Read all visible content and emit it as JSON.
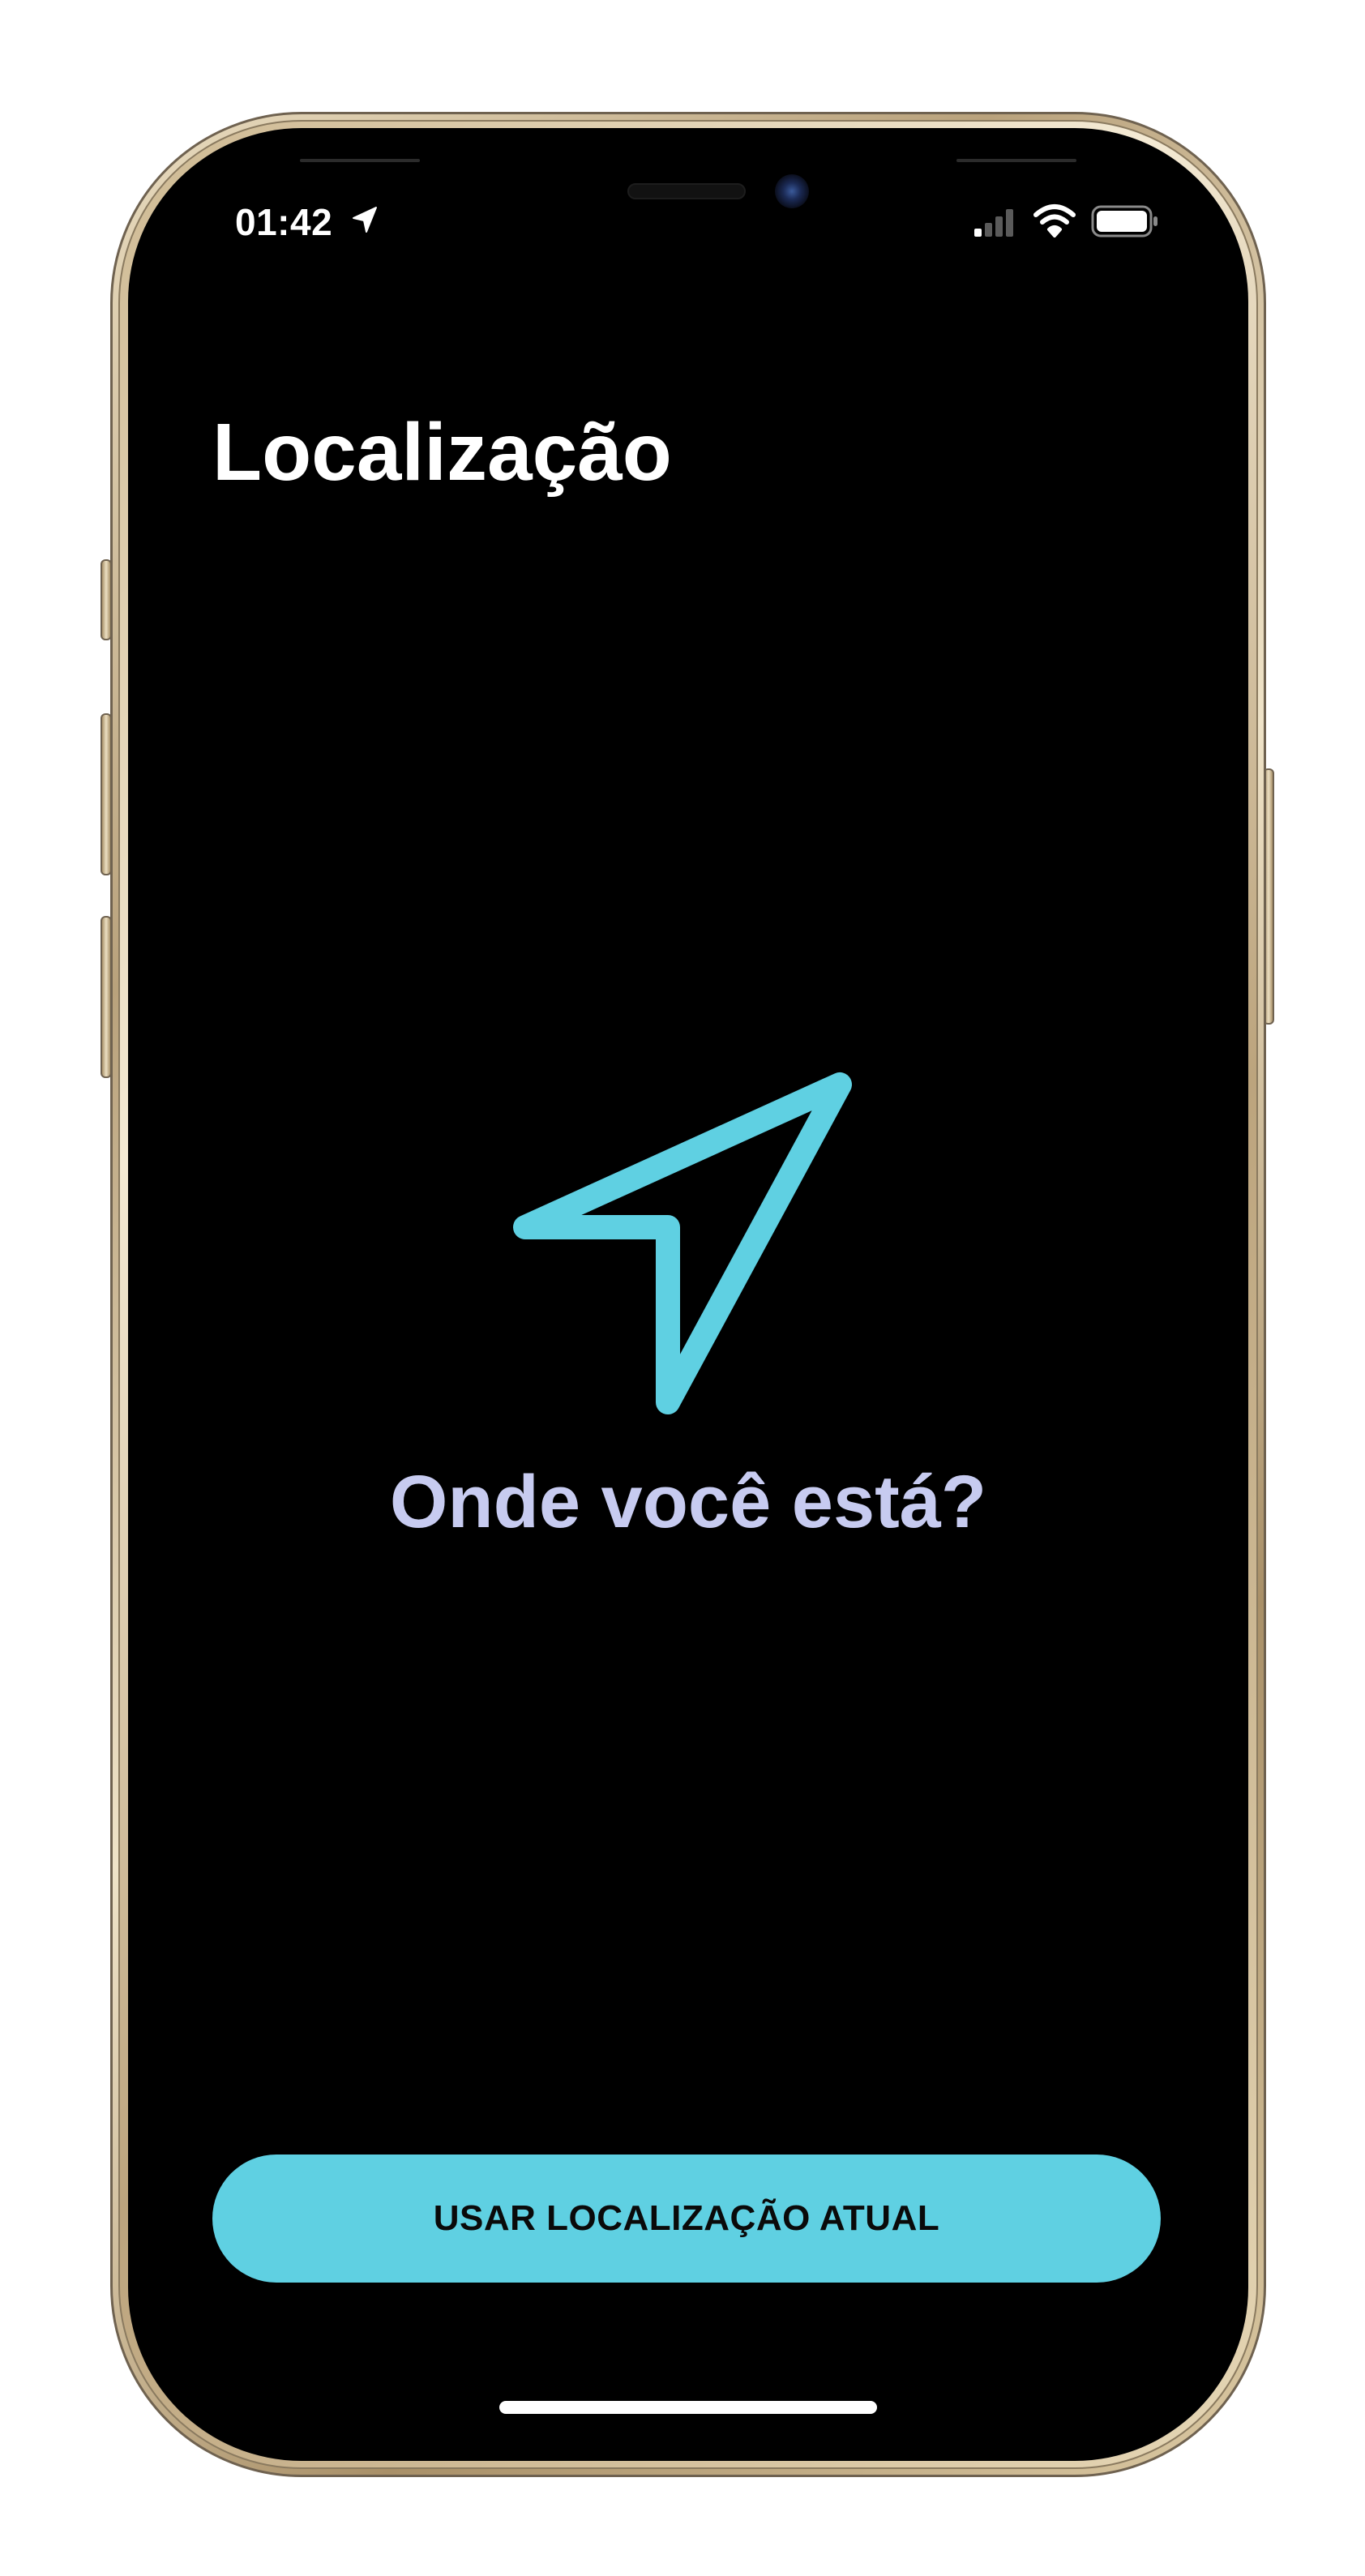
{
  "status_bar": {
    "time": "01:42",
    "location_icon": "location-arrow-icon",
    "signal_icon": "cellular-signal-icon",
    "wifi_icon": "wifi-icon",
    "battery_icon": "battery-full-icon"
  },
  "header": {
    "title": "Localização"
  },
  "main": {
    "icon": "navigation-arrow-icon",
    "prompt": "Onde você está?"
  },
  "actions": {
    "use_current_location_label": "USAR LOCALIZAÇÃO ATUAL"
  },
  "colors": {
    "background": "#000000",
    "accent": "#5fd0e2",
    "prompt_text": "#c7cbf0",
    "frame": "#c9b48c"
  }
}
